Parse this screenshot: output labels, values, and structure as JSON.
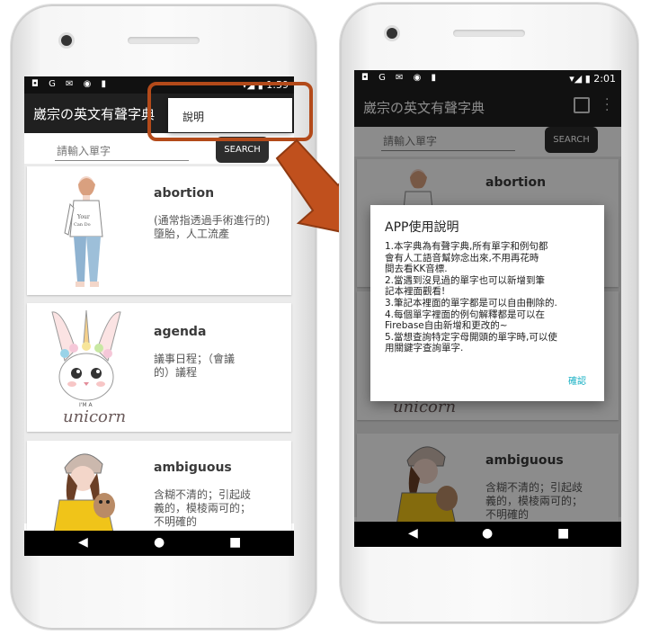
{
  "left_phone": {
    "statusbar": {
      "icons_left": "◘ G ✉ ◉ ▮",
      "time": "1:59"
    },
    "appbar": {
      "title": "崴宗の英文有聲字典"
    },
    "menu_popup": {
      "item_label": "說明"
    },
    "search": {
      "placeholder": "請輸入單字",
      "button_label": "SEARCH"
    },
    "words": [
      {
        "word": "abortion",
        "definition_lines": [
          "(通常指透過手術進行的)",
          "墮胎，人工流產"
        ],
        "image": "girl-illustration"
      },
      {
        "word": "agenda",
        "definition_lines": [
          "議事日程；（會議",
          "的）議程"
        ],
        "image": "unicorn-bunny-illustration"
      },
      {
        "word": "ambiguous",
        "definition_lines": [
          "含糊不清的；引起歧",
          "義的，模棱兩可的；",
          "不明確的"
        ],
        "image": "girl-with-dog-illustration"
      }
    ],
    "unicorn_caption": {
      "small": "I'M A",
      "big": "unicorn"
    },
    "navbar": {
      "back": "◀",
      "home": "●",
      "recent": "■"
    }
  },
  "right_phone": {
    "statusbar": {
      "icons_left": "◘ G ✉ ◉ ▮",
      "time": "2:01"
    },
    "appbar": {
      "title": "崴宗の英文有聲字典"
    },
    "search": {
      "placeholder": "請輸入單字",
      "button_label": "SEARCH"
    },
    "words": [
      {
        "word": "abortion"
      },
      {
        "word": "ambiguous",
        "definition_lines": [
          "含糊不清的；引起歧",
          "義的，模棱兩可的；",
          "不明確的"
        ]
      }
    ],
    "unicorn_caption": {
      "big": "unicorn"
    },
    "dialog": {
      "title": "APP使用說明",
      "lines": [
        "1.本字典為有聲字典,所有單字和例句都",
        "會有人工語音幫妳念出來,不用再花時",
        "間去看KK音標.",
        "2.當遇到沒見過的單字也可以新增到筆",
        "記本裡面觀看!",
        "3.筆記本裡面的單字都是可以自由刪除的.",
        "4.每個單字裡面的例句解釋都是可以在",
        "Firebase自由新增和更改的~",
        "5.當想查詢特定字母開頭的單字時,可以使",
        "用關鍵字查詢單字."
      ],
      "confirm_label": "確認"
    },
    "navbar": {
      "back": "◀",
      "home": "●",
      "recent": "■"
    }
  },
  "colors": {
    "accent": "#b34a1a",
    "link": "#17b0c4",
    "appbar": "#202020"
  }
}
